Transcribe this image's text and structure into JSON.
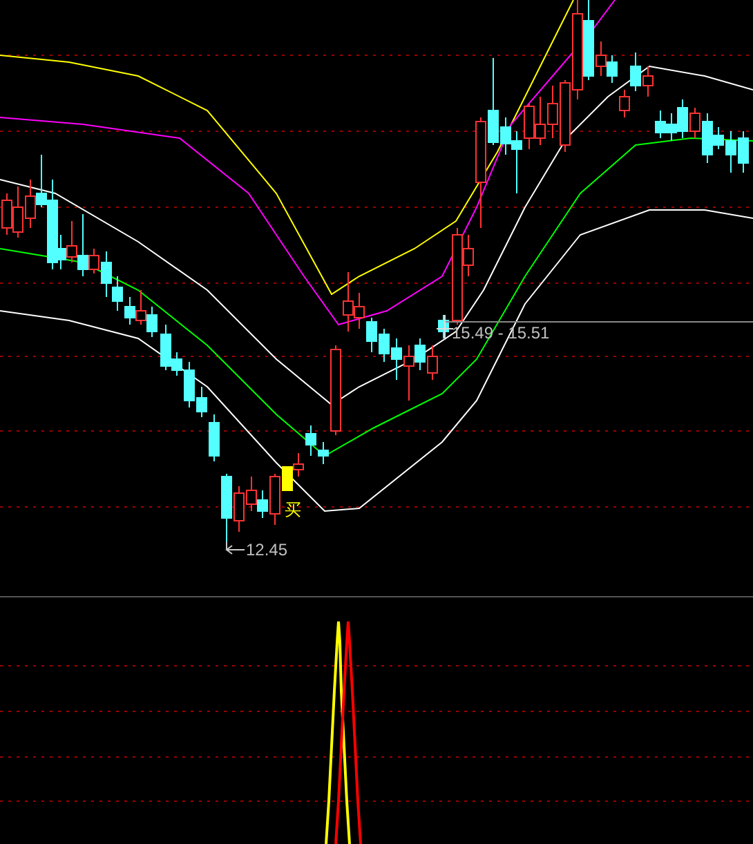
{
  "price_panel": {
    "low_label": "12.45",
    "range_label": "15.49 - 15.51",
    "buy_signal": "买"
  }
}
